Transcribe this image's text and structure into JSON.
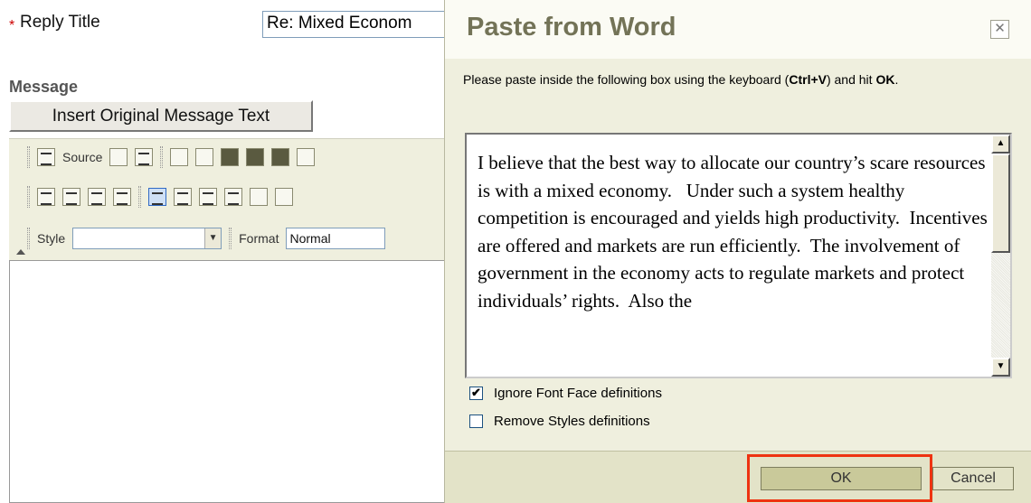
{
  "form": {
    "required_marker": "*",
    "reply_title_label": "Reply Title",
    "reply_title_value": "Re: Mixed Econom",
    "message_label": "Message",
    "insert_button_label": "Insert Original Message Text"
  },
  "editor_toolbar": {
    "source_label": "Source",
    "style_label": "Style",
    "style_value": "",
    "format_label": "Format",
    "format_value": "Normal"
  },
  "dialog": {
    "title": "Paste from Word",
    "close_icon": "close-icon",
    "instruction_prefix": "Please paste inside the following box using the keyboard (",
    "instruction_shortcut": "Ctrl+V",
    "instruction_middle": ") and hit ",
    "instruction_ok": "OK",
    "instruction_suffix": ".",
    "pasted_text": "I believe that the best way to allocate our country’s scare resources is with a mixed economy.   Under such a system healthy competition is encouraged and yields high productivity.  Incentives are offered and markets are run efficiently.  The involvement of government in the economy acts to regulate markets and protect individuals’ rights.  Also the",
    "options": [
      {
        "label": "Ignore Font Face definitions",
        "checked": true,
        "mark": "✔"
      },
      {
        "label": "Remove Styles definitions",
        "checked": false,
        "mark": ""
      }
    ],
    "ok_label": "OK",
    "cancel_label": "Cancel",
    "highlight_color": "#ee3311"
  }
}
